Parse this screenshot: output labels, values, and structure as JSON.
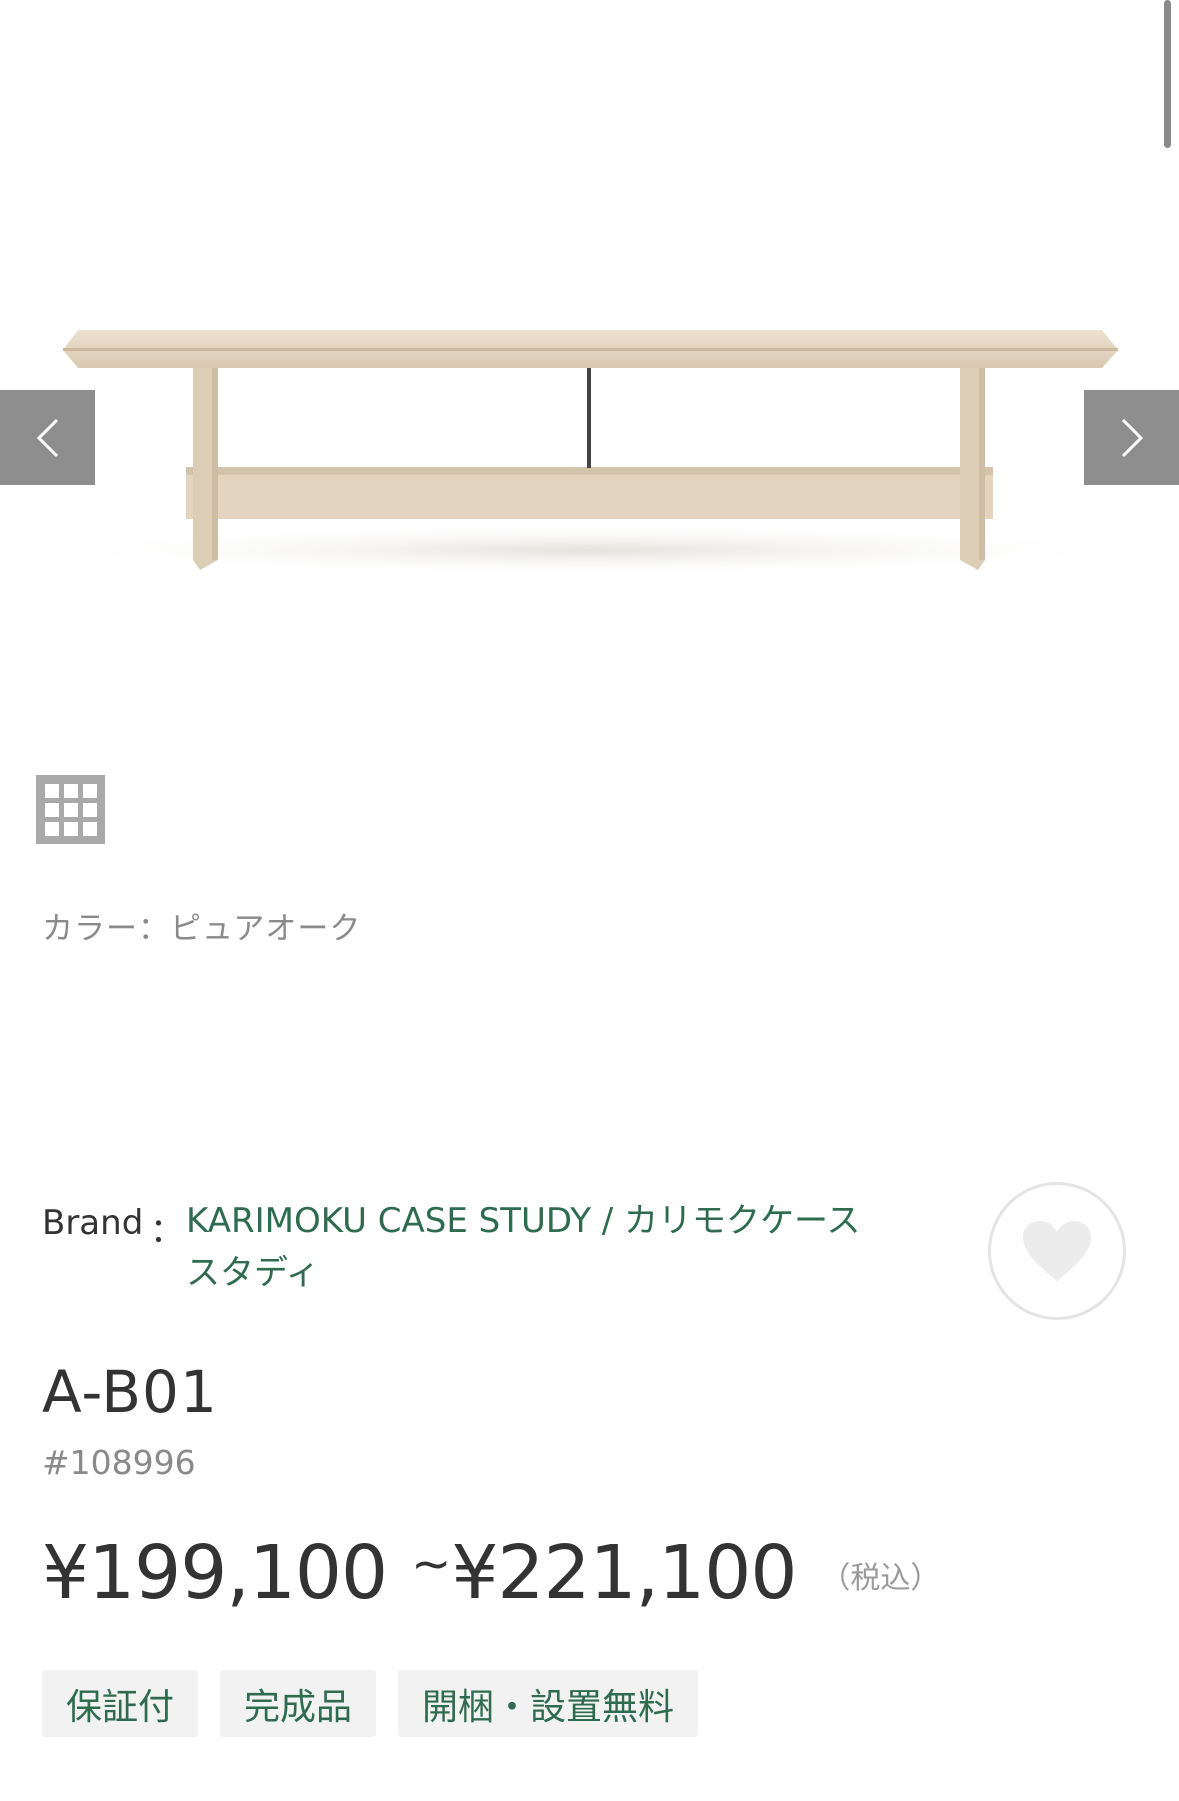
{
  "gallery": {
    "image_alt": "A-B01 bench pure oak",
    "prev_icon": "chevron-left-icon",
    "next_icon": "chevron-right-icon",
    "thumbnails_icon": "grid-icon"
  },
  "color": {
    "label": "カラー：ピュアオーク"
  },
  "brand": {
    "key": "Brand",
    "colon": "：",
    "name": "KARIMOKU CASE STUDY / カリモクケーススタディ"
  },
  "favorite": {
    "icon": "heart-icon"
  },
  "product": {
    "name": "A-B01",
    "code": "#108996"
  },
  "price": {
    "min": "¥199,100",
    "separator": "~",
    "max": "¥221,100",
    "tax_note": "（税込）"
  },
  "tags": [
    "保証付",
    "完成品",
    "開梱・設置無料"
  ],
  "colors": {
    "accent_green": "#2e6b4f",
    "nav_gray": "#8e8e8e",
    "tag_bg": "#f2f2f2"
  }
}
